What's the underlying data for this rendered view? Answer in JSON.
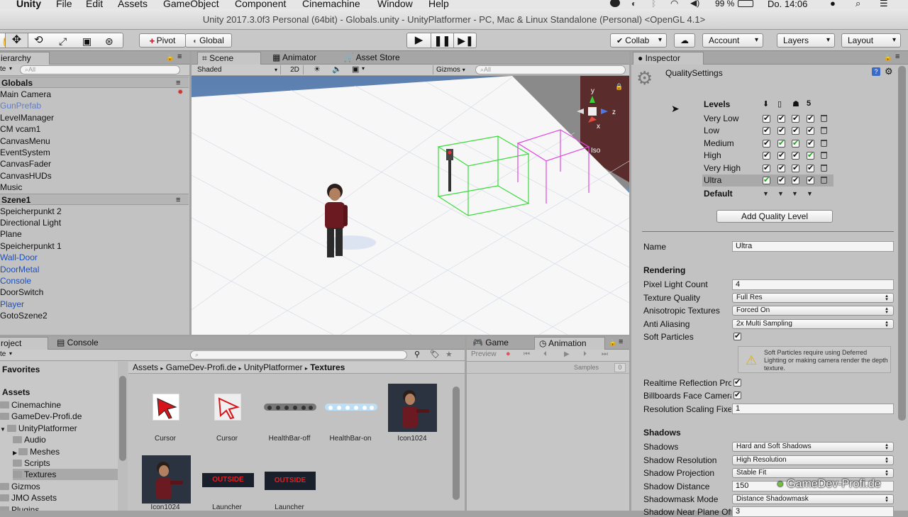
{
  "menubar": {
    "app": "Unity",
    "items": [
      "File",
      "Edit",
      "Assets",
      "GameObject",
      "Component",
      "Cinemachine",
      "Window",
      "Help"
    ],
    "battery": "99 %",
    "clock": "Do. 14:06"
  },
  "window": {
    "title": "Unity 2017.3.0f3 Personal (64bit) - Globals.unity - UnityPlatformer - PC, Mac & Linux Standalone (Personal) <OpenGL 4.1>"
  },
  "toolbar": {
    "pivot": "Pivot",
    "global": "Global",
    "collab": "Collab",
    "account": "Account",
    "layers": "Layers",
    "layout": "Layout"
  },
  "hierarchy": {
    "tab": "ierarchy",
    "create": "te",
    "search_placeholder": "All",
    "scenes": [
      {
        "name": "Globals",
        "items": [
          {
            "label": "Main Camera",
            "style": ""
          },
          {
            "label": "GunPrefab",
            "style": "lblue"
          },
          {
            "label": "LevelManager",
            "style": ""
          },
          {
            "label": "CM vcam1",
            "style": ""
          },
          {
            "label": "CanvasMenu",
            "style": ""
          },
          {
            "label": "EventSystem",
            "style": ""
          },
          {
            "label": "CanvasFader",
            "style": ""
          },
          {
            "label": "CanvasHUDs",
            "style": ""
          },
          {
            "label": "Music",
            "style": ""
          }
        ]
      },
      {
        "name": "Szene1",
        "items": [
          {
            "label": "Speicherpunkt 2",
            "style": ""
          },
          {
            "label": "Directional Light",
            "style": ""
          },
          {
            "label": "Plane",
            "style": ""
          },
          {
            "label": "Speicherpunkt 1",
            "style": ""
          },
          {
            "label": "Wall-Door",
            "style": "blue"
          },
          {
            "label": "DoorMetal",
            "style": "blue"
          },
          {
            "label": "Console",
            "style": "blue"
          },
          {
            "label": "DoorSwitch",
            "style": ""
          },
          {
            "label": "Player",
            "style": "blue"
          },
          {
            "label": "GotoSzene2",
            "style": ""
          }
        ]
      }
    ]
  },
  "scene": {
    "tabs": [
      "Scene",
      "Animator",
      "Asset Store"
    ],
    "shading": "Shaded",
    "mode2d": "2D",
    "gizmos": "Gizmos",
    "search_placeholder": "All",
    "axis_y": "y",
    "axis_z": "z",
    "axis_x": "x",
    "iso": "Iso"
  },
  "project": {
    "tabs": [
      "roject",
      "Console"
    ],
    "create": "te",
    "favorites": "Favorites",
    "assets": "Assets",
    "tree": [
      {
        "label": "Cinemachine",
        "indent": 0
      },
      {
        "label": "GameDev-Profi.de",
        "indent": 0
      },
      {
        "label": "UnityPlatformer",
        "indent": 0
      },
      {
        "label": "Audio",
        "indent": 1
      },
      {
        "label": "Meshes",
        "indent": 1
      },
      {
        "label": "Scripts",
        "indent": 1
      },
      {
        "label": "Textures",
        "indent": 1
      },
      {
        "label": "Gizmos",
        "indent": 0
      },
      {
        "label": "JMO Assets",
        "indent": 0
      },
      {
        "label": "Plugins",
        "indent": 0
      }
    ],
    "breadcrumb": [
      "Assets",
      "GameDev-Profi.de",
      "UnityPlatformer",
      "Textures"
    ],
    "grid": [
      "Cursor",
      "Cursor",
      "HealthBar-off",
      "HealthBar-on",
      "Icon1024",
      "Icon1024",
      "Launcher",
      "Launcher"
    ],
    "launcher_text": "OUTSIDE"
  },
  "animation": {
    "tabs": [
      "Game",
      "Animation"
    ],
    "preview": "Preview",
    "samples": "Samples",
    "samples_value": "0"
  },
  "inspector": {
    "tab": "Inspector",
    "component": "QualitySettings",
    "levels_header": "Levels",
    "levels": [
      {
        "name": "Very Low",
        "checks": [
          1,
          1,
          1,
          1
        ],
        "green": [
          0,
          0,
          0,
          0
        ]
      },
      {
        "name": "Low",
        "checks": [
          1,
          1,
          1,
          1
        ],
        "green": [
          0,
          0,
          0,
          0
        ]
      },
      {
        "name": "Medium",
        "checks": [
          1,
          1,
          1,
          1
        ],
        "green": [
          0,
          1,
          1,
          0
        ]
      },
      {
        "name": "High",
        "checks": [
          1,
          1,
          1,
          1
        ],
        "green": [
          0,
          0,
          0,
          1
        ]
      },
      {
        "name": "Very High",
        "checks": [
          1,
          1,
          1,
          1
        ],
        "green": [
          0,
          0,
          0,
          0
        ]
      },
      {
        "name": "Ultra",
        "checks": [
          1,
          1,
          1,
          1
        ],
        "green": [
          1,
          0,
          0,
          0
        ]
      }
    ],
    "default_label": "Default",
    "add_level": "Add Quality Level",
    "name_label": "Name",
    "name_value": "Ultra",
    "rendering": "Rendering",
    "pixel_light_label": "Pixel Light Count",
    "pixel_light_value": "4",
    "texture_quality_label": "Texture Quality",
    "texture_quality_value": "Full Res",
    "aniso_label": "Anisotropic Textures",
    "aniso_value": "Forced On",
    "aa_label": "Anti Aliasing",
    "aa_value": "2x Multi Sampling",
    "soft_particles_label": "Soft Particles",
    "soft_particles_warning": "Soft Particles require using Deferred Lighting or making camera render the depth texture.",
    "realtime_reflection_label": "Realtime Reflection Pro",
    "billboards_label": "Billboards Face Camera",
    "res_scaling_label": "Resolution Scaling Fixe",
    "res_scaling_value": "1",
    "shadows_header": "Shadows",
    "shadows_label": "Shadows",
    "shadows_value": "Hard and Soft Shadows",
    "shadow_res_label": "Shadow Resolution",
    "shadow_res_value": "High Resolution",
    "shadow_proj_label": "Shadow Projection",
    "shadow_proj_value": "Stable Fit",
    "shadow_dist_label": "Shadow Distance",
    "shadow_dist_value": "150",
    "shadowmask_label": "Shadowmask Mode",
    "shadowmask_value": "Distance Shadowmask",
    "near_plane_label": "Shadow Near Plane Off",
    "near_plane_value": "3"
  },
  "watermark": "GameDev-Profi.de"
}
